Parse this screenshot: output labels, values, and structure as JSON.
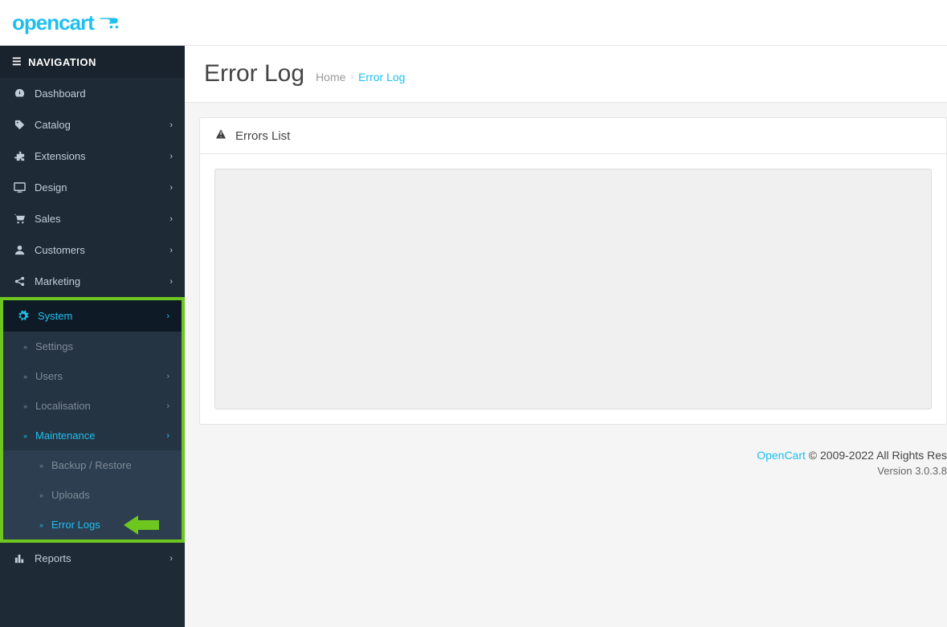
{
  "header": {
    "logo_text": "opencart"
  },
  "sidebar": {
    "nav_label": "NAVIGATION",
    "items": [
      {
        "label": "Dashboard",
        "icon": "dashboard-icon",
        "chevron": false
      },
      {
        "label": "Catalog",
        "icon": "tag-icon",
        "chevron": true
      },
      {
        "label": "Extensions",
        "icon": "puzzle-icon",
        "chevron": true
      },
      {
        "label": "Design",
        "icon": "monitor-icon",
        "chevron": true
      },
      {
        "label": "Sales",
        "icon": "cart-icon",
        "chevron": true
      },
      {
        "label": "Customers",
        "icon": "user-icon",
        "chevron": true
      },
      {
        "label": "Marketing",
        "icon": "share-icon",
        "chevron": true
      }
    ],
    "system": {
      "label": "System",
      "items": [
        {
          "label": "Settings",
          "chevron": false
        },
        {
          "label": "Users",
          "chevron": true
        },
        {
          "label": "Localisation",
          "chevron": true
        }
      ],
      "maintenance": {
        "label": "Maintenance",
        "items": [
          {
            "label": "Backup / Restore"
          },
          {
            "label": "Uploads"
          },
          {
            "label": "Error Logs"
          }
        ]
      }
    },
    "reports": {
      "label": "Reports"
    }
  },
  "page": {
    "title": "Error Log",
    "breadcrumb": {
      "home": "Home",
      "current": "Error Log"
    },
    "panel_title": "Errors List",
    "log_content": ""
  },
  "footer": {
    "link": "OpenCart",
    "copyright": " © 2009-2022 All Rights Res",
    "version": "Version 3.0.3.8"
  }
}
